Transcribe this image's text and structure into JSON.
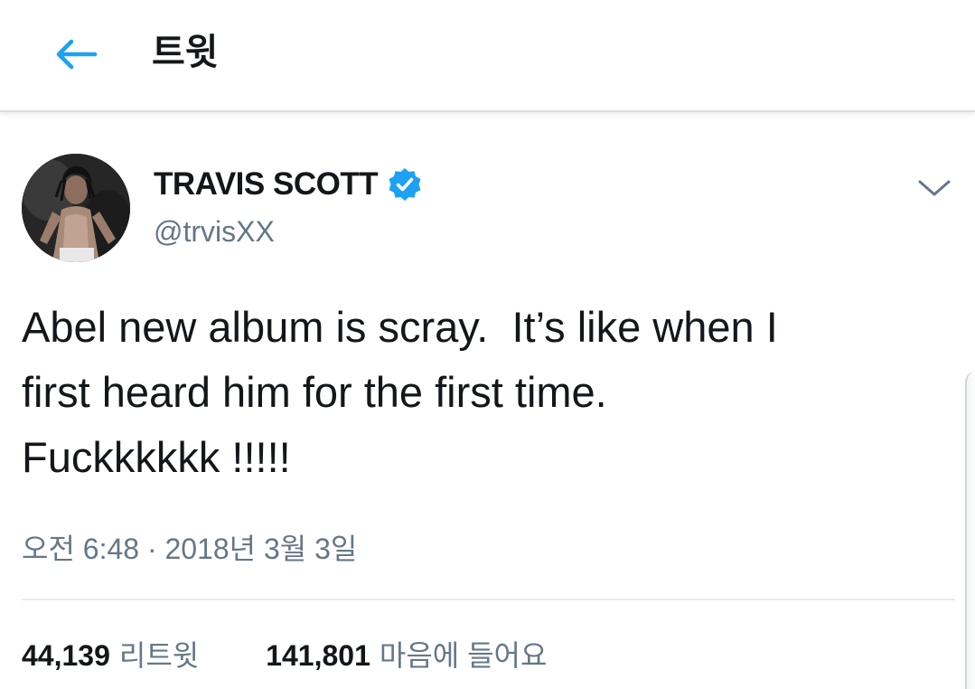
{
  "header": {
    "title": "트윗",
    "back_icon": "arrow-left-icon",
    "accent_color": "#1da1f2"
  },
  "tweet": {
    "author": {
      "display_name": "TRAVIS SCOTT",
      "handle": "@trvisXX",
      "verified": true,
      "verified_icon": "verified-badge-icon"
    },
    "menu_icon": "chevron-down-icon",
    "text": "Abel new album is scray.  It’s like when I\nfirst heard him for the first time.\nFuckkkkkk !!!!!",
    "timestamp": "오전 6:48 · 2018년 3월 3일",
    "stats": {
      "retweets_count": "44,139",
      "retweets_label": "리트윗",
      "likes_count": "141,801",
      "likes_label": "마음에 들어요"
    }
  }
}
